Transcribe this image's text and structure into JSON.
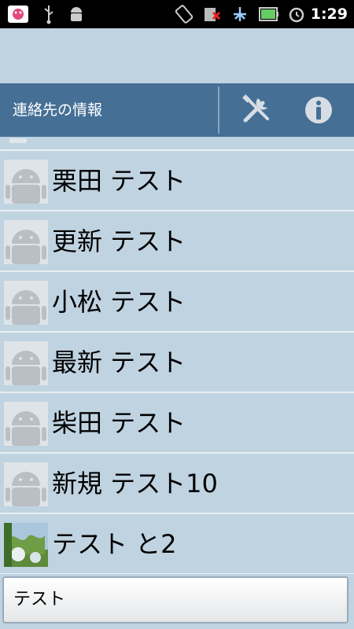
{
  "status_bar": {
    "time": "1:29",
    "icons": [
      "app-notification-icon",
      "usb-icon",
      "android-debug-icon",
      "rotate-icon",
      "no-sim-icon",
      "signal-icon",
      "battery-icon",
      "alarm-icon"
    ]
  },
  "toolbar": {
    "title": "連絡先の情報",
    "tools_icon": "tools-icon",
    "info_icon": "info-icon"
  },
  "contacts": [
    {
      "name": "栗田 テスト",
      "avatar": "android-default-avatar"
    },
    {
      "name": "更新 テスト",
      "avatar": "android-default-avatar"
    },
    {
      "name": "小松 テスト",
      "avatar": "android-default-avatar"
    },
    {
      "name": "最新 テスト",
      "avatar": "android-default-avatar"
    },
    {
      "name": "柴田 テスト",
      "avatar": "android-default-avatar"
    },
    {
      "name": "新規 テスト10",
      "avatar": "android-default-avatar"
    },
    {
      "name": "テスト と2",
      "avatar": "photo-avatar"
    }
  ],
  "search": {
    "value": "テスト"
  },
  "colors": {
    "background": "#c0d3e1",
    "toolbar": "#456f95",
    "status_bar": "#000000"
  }
}
